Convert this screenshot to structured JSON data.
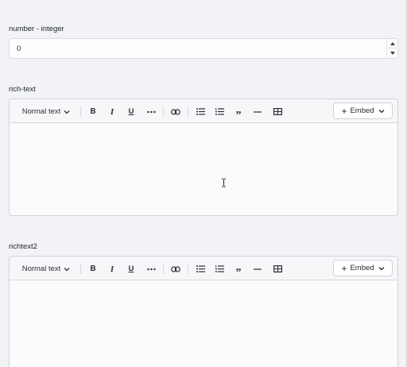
{
  "fields": {
    "number": {
      "label": "number - integer",
      "value": "0"
    },
    "rich_text": {
      "label": "rich-text"
    },
    "richtext2": {
      "label": "richtext2"
    }
  },
  "toolbar": {
    "text_style": "Normal text",
    "embed_label": "Embed",
    "icons": [
      "bold-icon",
      "italic-icon",
      "underline-icon",
      "more-icon",
      "link-icon",
      "bullet-list-icon",
      "numbered-list-icon",
      "quote-icon",
      "horizontal-rule-icon",
      "table-icon",
      "plus-icon",
      "chevron-down-icon"
    ],
    "bold": "B",
    "italic": "I",
    "underline": "U",
    "quote": "”"
  }
}
